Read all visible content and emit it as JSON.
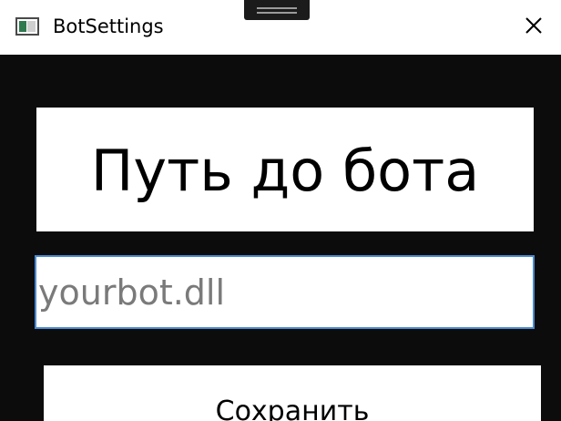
{
  "window": {
    "title": "BotSettings",
    "app_icon": "window-app-icon",
    "close_icon": "close-icon",
    "grip_icon": "drag-grip-icon"
  },
  "header": {
    "text": "Путь до бота"
  },
  "path_input": {
    "value": "",
    "placeholder": "yourbot.dll"
  },
  "save_button": {
    "label": "Сохранить"
  },
  "colors": {
    "background": "#0c0c0c",
    "panel": "#ffffff",
    "input_border": "#4a8ad0",
    "placeholder": "#7a7a7a"
  }
}
